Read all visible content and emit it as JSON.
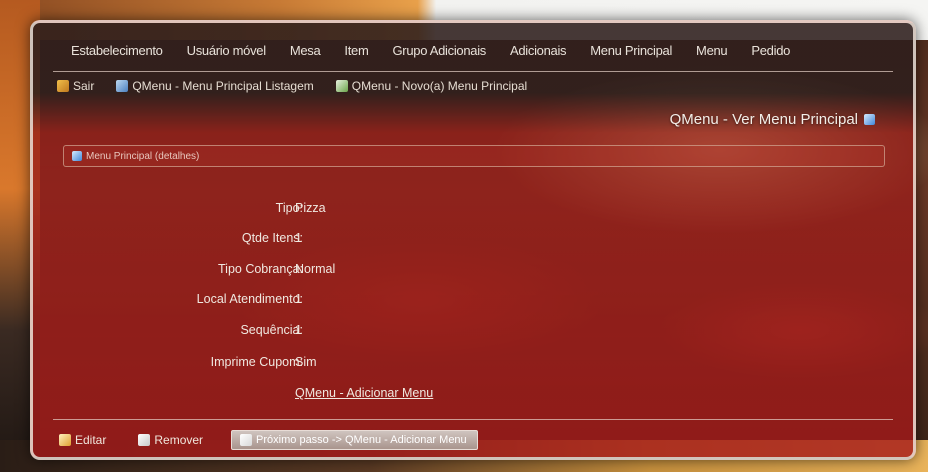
{
  "menu": {
    "items": [
      "Estabelecimento",
      "Usuário móvel",
      "Mesa",
      "Item",
      "Grupo Adicionais",
      "Adicionais",
      "Menu Principal",
      "Menu",
      "Pedido"
    ]
  },
  "links": {
    "exit": "Sair",
    "list": "QMenu - Menu Principal Listagem",
    "new": "QMenu - Novo(a) Menu Principal"
  },
  "page_title": "QMenu - Ver Menu Principal",
  "section": {
    "header": "Menu Principal (detalhes)"
  },
  "fields": [
    {
      "label": "Tipo:",
      "value": "Pizza"
    },
    {
      "label": "Qtde Itens:",
      "value": "1"
    },
    {
      "label": "Tipo Cobrança:",
      "value": "Normal"
    },
    {
      "label": "Local Atendimento:",
      "value": "1"
    },
    {
      "label": "Sequência:",
      "value": "1"
    },
    {
      "label": "Imprime Cupom:",
      "value": "Sim"
    }
  ],
  "add_menu_link": "QMenu - Adicionar Menu",
  "footer": {
    "edit": "Editar",
    "remove": "Remover",
    "next_step": "Próximo passo -> QMenu - Adicionar Menu"
  },
  "colors": {
    "panel_red": "#a5191a",
    "panel_dark": "#2d1e1c",
    "text_light": "#f0e8e0"
  }
}
